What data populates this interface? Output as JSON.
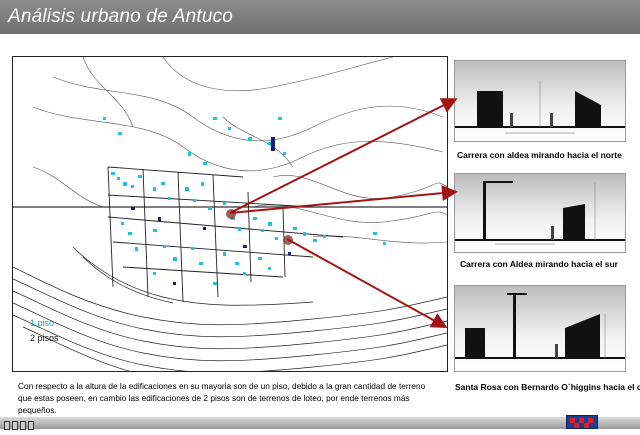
{
  "header": {
    "title": "Análisis urbano de Antuco"
  },
  "legend": {
    "one_floor": "1 piso",
    "two_floors": "2 pisos"
  },
  "sections": [
    {
      "caption": "Carrera con aldea mirando  hacia el norte"
    },
    {
      "caption": "Carrera  con Aldea mirando hacia el sur"
    },
    {
      "caption": "Santa Rosa con Bernardo O´higgins hacia el oeste"
    }
  ],
  "description": "Con respecto a la altura de la edificaciones en su mayoria son de un piso, debido a la gran cantidad de terreno que estas poseen, en cambio las edificaciones de 2 pisos son de terrenos de loteo, por ende terrenos más pequeños.",
  "colors": {
    "one_floor": "#1ec3d6",
    "two_floors": "#1a1a6e",
    "arrow": "#a31515",
    "header": "#7a7a7a"
  }
}
